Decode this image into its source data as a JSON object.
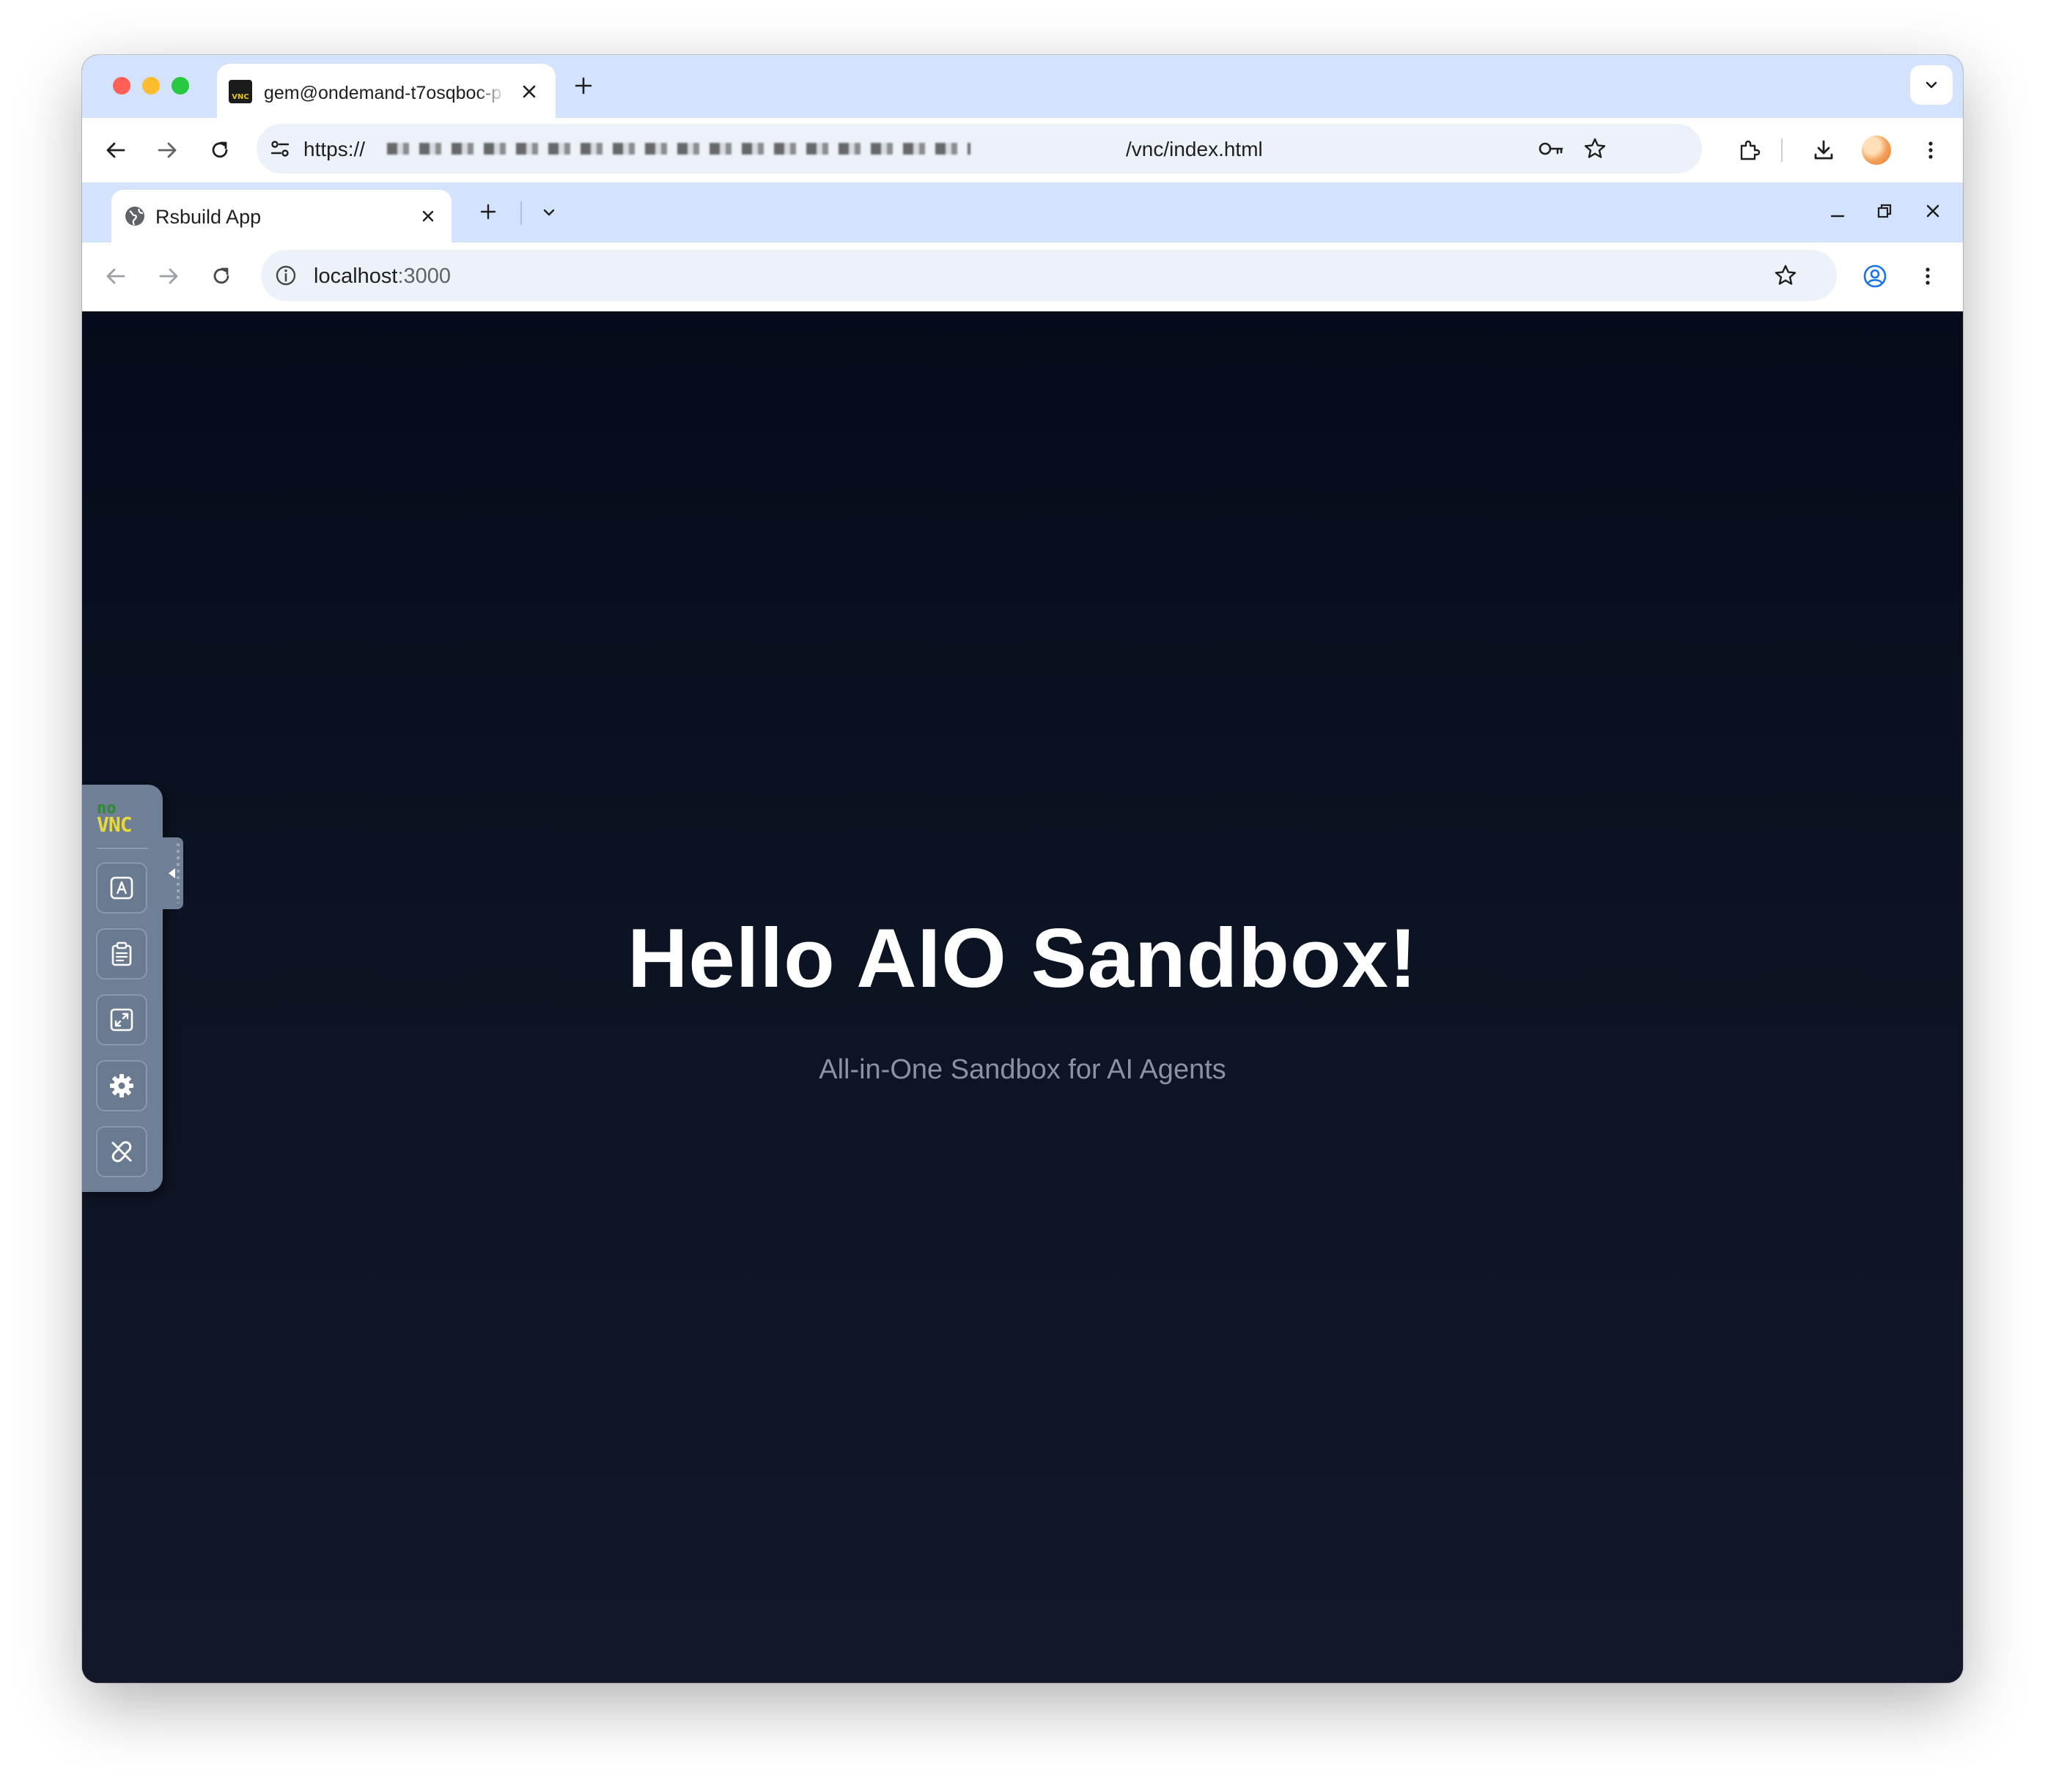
{
  "outer_browser": {
    "tab": {
      "favicon_text": "VNC",
      "title": "gem@ondemand-t7osqboc-p"
    },
    "omnibox": {
      "url_prefix": "https://",
      "url_suffix": "/vnc/index.html"
    }
  },
  "inner_browser": {
    "tab": {
      "title": "Rsbuild App"
    },
    "omnibox": {
      "host": "localhost",
      "port": ":3000"
    }
  },
  "page": {
    "title": "Hello AIO Sandbox!",
    "subtitle": "All-in-One Sandbox for AI Agents"
  },
  "novnc": {
    "logo_no": "no",
    "logo_vnc": "VNC",
    "buttons": [
      {
        "icon": "keyboard-icon"
      },
      {
        "icon": "clipboard-icon"
      },
      {
        "icon": "fullscreen-icon"
      },
      {
        "icon": "settings-gear-icon"
      },
      {
        "icon": "disconnect-icon"
      }
    ]
  },
  "colors": {
    "tabstrip": "#d3e3fd",
    "page_background": "#0e1422",
    "title_text": "#ffffff",
    "subtitle_text": "#8a93a6",
    "novnc_bar": "#6f7f96",
    "logo_green": "#2e8b32",
    "logo_yellow": "#e8d83b"
  }
}
